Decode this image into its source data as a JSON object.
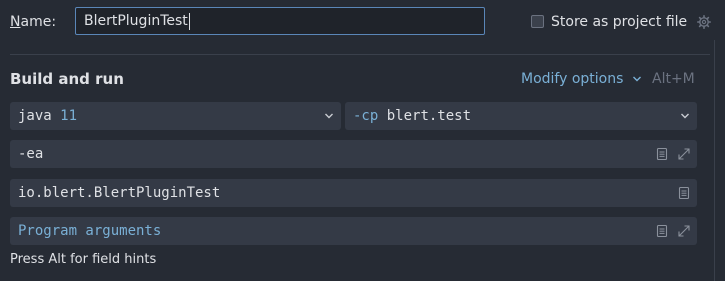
{
  "name_row": {
    "label_mnemonic": "N",
    "label_rest": "ame:",
    "value": "BlertPluginTest",
    "store_label": "Store as project file",
    "store_checked": false,
    "store_icon": "gear-icon"
  },
  "build_run": {
    "title": "Build and run",
    "modify_options": "Modify options",
    "modify_icon": "chevron-down-icon",
    "shortcut": "Alt+M",
    "jdk": {
      "prefix": "java",
      "version": "11"
    },
    "classpath": {
      "flag": "-cp",
      "module": "blert.test"
    },
    "vm_options": "-ea",
    "main_class": "io.blert.BlertPluginTest",
    "program_args_placeholder": "Program arguments",
    "hint": "Press Alt for field hints"
  },
  "colors": {
    "background": "#262b34",
    "field": "#343a46",
    "accent": "#7ab0d6",
    "focus_border": "#5a86b8"
  }
}
